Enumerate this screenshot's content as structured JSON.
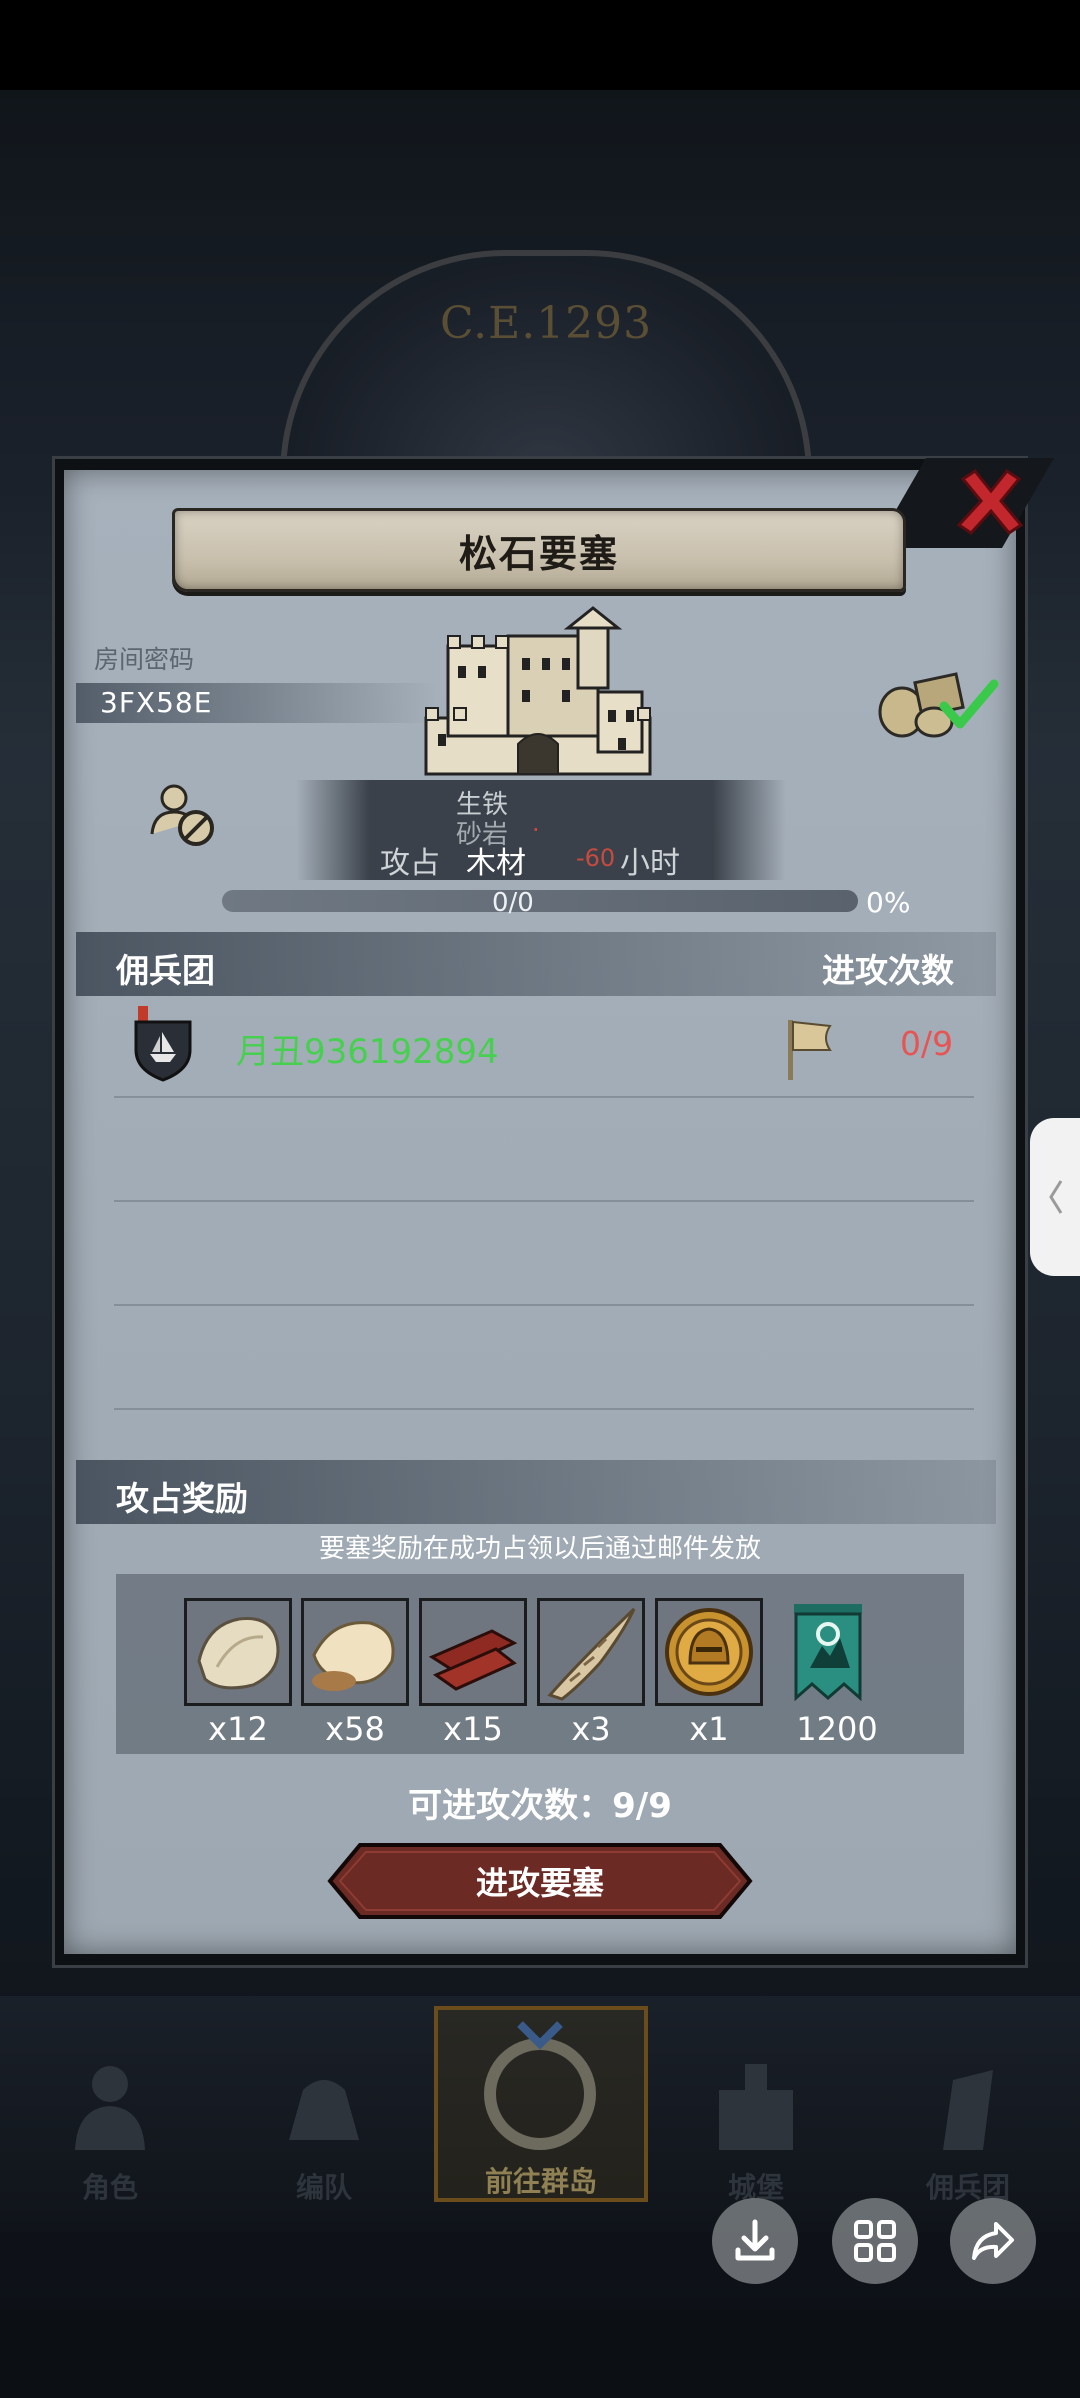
{
  "game": {
    "year": "C.E.1293"
  },
  "modal": {
    "title": "松石要塞",
    "room_label": "房间密码",
    "room_code": "3FX58E",
    "resources": {
      "iron": {
        "label": "生铁",
        "value": ""
      },
      "sandstone": {
        "label": "砂岩",
        "value": "·"
      },
      "wood": {
        "label": "木材",
        "value": "-60"
      }
    },
    "attack_time_text": "攻占",
    "attack_time_suffix": "小时",
    "progress": {
      "count": "0/0",
      "percent": "0%",
      "fraction": 0
    },
    "mercenary_section": {
      "title": "佣兵团",
      "attack_count_title": "进攻次数"
    },
    "member": {
      "name": "月丑936192894",
      "attack_count": "0/9"
    },
    "reward_section": {
      "title": "攻占奖励",
      "note": "要塞奖励在成功占领以后通过邮件发放"
    },
    "rewards": [
      {
        "icon": "hide-pelt-icon",
        "qty": "x12"
      },
      {
        "icon": "fur-pelt-icon",
        "qty": "x58"
      },
      {
        "icon": "wood-planks-icon",
        "qty": "x15"
      },
      {
        "icon": "horn-icon",
        "qty": "x3"
      },
      {
        "icon": "knight-helmet-coin-icon",
        "qty": "x1"
      },
      {
        "icon": "guild-banner-icon",
        "qty": "1200"
      }
    ],
    "attacks_left": "可进攻次数：9/9",
    "attack_button": "进攻要塞"
  },
  "bottom_nav": {
    "items": [
      {
        "label": "角色"
      },
      {
        "label": "编队"
      },
      {
        "label": "前往群岛"
      },
      {
        "label": "城堡"
      },
      {
        "label": "佣兵团"
      }
    ],
    "active_index": 2
  },
  "colors": {
    "member_name": "#47d04f",
    "attack_count": "#e75454",
    "close_x": "#c1272d",
    "button_fill": "#6b2a24"
  }
}
